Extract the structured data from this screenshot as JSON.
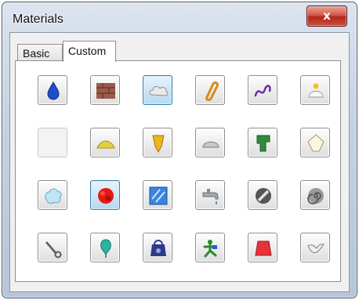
{
  "window": {
    "title": "Materials",
    "close_label": "x"
  },
  "tabs": [
    {
      "label": "Basic",
      "active": false
    },
    {
      "label": "Custom",
      "active": true
    }
  ],
  "materials": [
    [
      "water-drop-icon",
      "bricks-icon",
      "cloud-icon",
      "chain-link-icon",
      "squiggle-icon",
      "cake-icon"
    ],
    [
      "empty-slot",
      "sand-pile-icon",
      "acorn-icon",
      "stone-icon",
      "pipe-icon",
      "gem-icon"
    ],
    [
      "foam-icon",
      "rubber-icon",
      "glass-icon",
      "faucet-icon",
      "no-entry-icon",
      "spiral-icon"
    ],
    [
      "rope-icon",
      "balloon-icon",
      "weight-icon",
      "figure-icon",
      "red-block-icon",
      "bird-icon"
    ]
  ],
  "selected_slots": [
    "cloud-icon",
    "rubber-icon"
  ],
  "colors": {
    "accent_selected": "#3c7fb1",
    "close_button": "#c84636",
    "window_frame": "#c5d2e2"
  }
}
